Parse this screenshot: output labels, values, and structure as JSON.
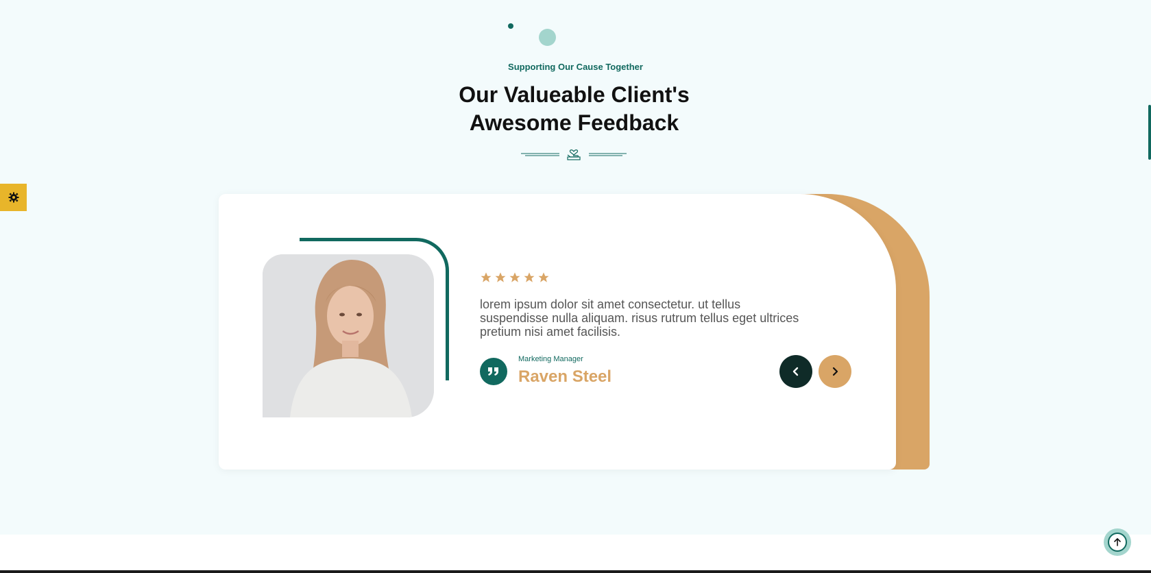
{
  "section": {
    "eyebrow": "Supporting Our Cause Together",
    "title_line1": "Our Valueable Client's",
    "title_line2": "Awesome Feedback"
  },
  "testimonial": {
    "rating": 5,
    "text": "lorem ipsum dolor sit amet consectetur. ut tellus suspendisse nulla aliquam. risus rutrum tellus eget ultrices pretium nisi amet facilisis.",
    "role": "Marketing Manager",
    "name": "Raven Steel",
    "photo_icon": "portrait-photo"
  },
  "controls": {
    "prev_icon": "chevron-left-icon",
    "next_icon": "chevron-right-icon",
    "settings_icon": "gear-icon",
    "back_to_top_icon": "arrow-up-icon"
  },
  "colors": {
    "background": "#f3fbfc",
    "primary": "#11695f",
    "accent": "#d9a566",
    "dark": "#0f2b28",
    "settings_tab": "#e8b52a"
  }
}
